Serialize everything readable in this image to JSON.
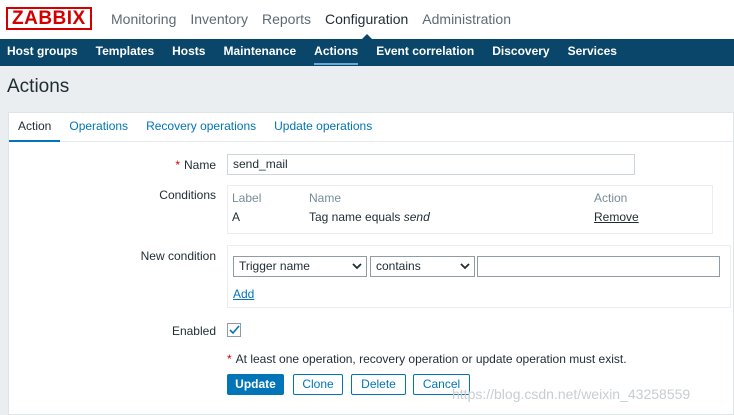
{
  "brand": {
    "logo_text": "ZABBIX",
    "logo_color": "#d40000",
    "accent": "#0275b8",
    "subnav_bg": "#0a466a"
  },
  "main_nav": [
    {
      "label": "Monitoring",
      "active": false
    },
    {
      "label": "Inventory",
      "active": false
    },
    {
      "label": "Reports",
      "active": false
    },
    {
      "label": "Configuration",
      "active": true
    },
    {
      "label": "Administration",
      "active": false
    }
  ],
  "sub_nav": [
    {
      "label": "Host groups",
      "active": false
    },
    {
      "label": "Templates",
      "active": false
    },
    {
      "label": "Hosts",
      "active": false
    },
    {
      "label": "Maintenance",
      "active": false
    },
    {
      "label": "Actions",
      "active": true
    },
    {
      "label": "Event correlation",
      "active": false
    },
    {
      "label": "Discovery",
      "active": false
    },
    {
      "label": "Services",
      "active": false
    }
  ],
  "page": {
    "title": "Actions"
  },
  "tabs": [
    {
      "label": "Action",
      "active": true
    },
    {
      "label": "Operations",
      "active": false
    },
    {
      "label": "Recovery operations",
      "active": false
    },
    {
      "label": "Update operations",
      "active": false
    }
  ],
  "form": {
    "name": {
      "required_mark": "*",
      "label": "Name",
      "value": "send_mail"
    },
    "conditions": {
      "label": "Conditions",
      "headers": {
        "label": "Label",
        "name": "Name",
        "action": "Action"
      },
      "rows": [
        {
          "label": "A",
          "name_prefix": "Tag name equals ",
          "name_value": "send",
          "action": "Remove"
        }
      ]
    },
    "new_condition": {
      "label": "New condition",
      "type_select": "Trigger name",
      "operator_select": "contains",
      "value": "",
      "add_label": "Add"
    },
    "enabled": {
      "label": "Enabled",
      "checked": true
    },
    "warning": {
      "mark": "*",
      "text": "At least one operation, recovery operation or update operation must exist."
    },
    "buttons": {
      "update": "Update",
      "clone": "Clone",
      "delete": "Delete",
      "cancel": "Cancel"
    }
  },
  "watermark": "https://blog.csdn.net/weixin_43258559"
}
